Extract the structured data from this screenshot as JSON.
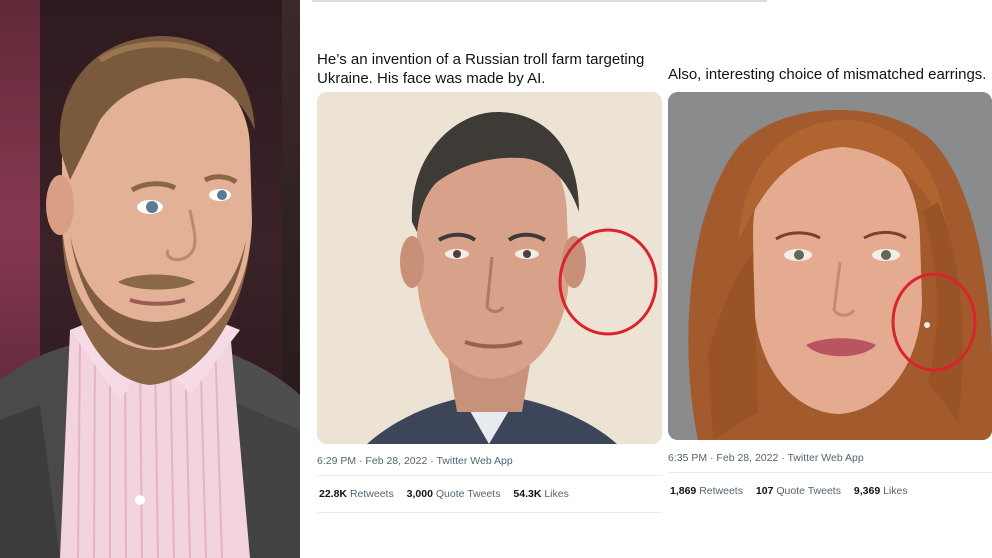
{
  "tweets": [
    {
      "text": "He’s an invention of a Russian troll farm targeting Ukraine. His face was made by AI.",
      "meta": "6:29 PM · Feb 28, 2022 · Twitter Web App",
      "stats": [
        {
          "value": "22.8K",
          "label": "Retweets"
        },
        {
          "value": "3,000",
          "label": "Quote Tweets"
        },
        {
          "value": "54.3K",
          "label": "Likes"
        }
      ]
    },
    {
      "text": "Also, interesting choice of mismatched earrings.",
      "meta": "6:35 PM · Feb 28, 2022 · Twitter Web App",
      "stats": [
        {
          "value": "1,869",
          "label": "Retweets"
        },
        {
          "value": "107",
          "label": "Quote Tweets"
        },
        {
          "value": "9,369",
          "label": "Likes"
        }
      ]
    }
  ],
  "colors": {
    "annotation_circle": "#d8242c",
    "text_primary": "#0f1419",
    "text_secondary": "#536471"
  }
}
